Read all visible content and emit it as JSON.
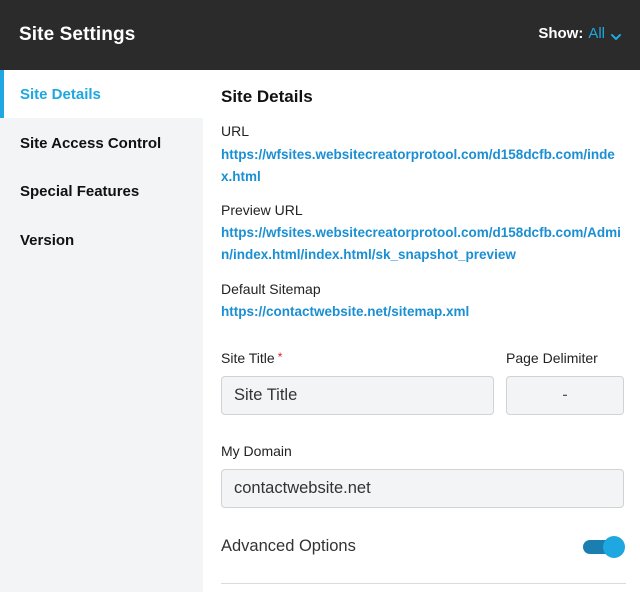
{
  "header": {
    "title": "Site Settings",
    "show_label": "Show:",
    "show_value": "All"
  },
  "sidebar": {
    "items": [
      {
        "label": "Site Details",
        "active": true
      },
      {
        "label": "Site Access Control",
        "active": false
      },
      {
        "label": "Special Features",
        "active": false
      },
      {
        "label": "Version",
        "active": false
      }
    ]
  },
  "main": {
    "section_title": "Site Details",
    "url_label": "URL",
    "url_value": "https://wfsites.websitecreatorprotool.com/d158dcfb.com/index.html",
    "preview_url_label": "Preview URL",
    "preview_url_value": "https://wfsites.websitecreatorprotool.com/d158dcfb.com/Admin/index.html/index.html/sk_snapshot_preview",
    "sitemap_label": "Default Sitemap",
    "sitemap_value": "https://contactwebsite.net/sitemap.xml",
    "site_title_label": "Site Title",
    "site_title_required": "*",
    "site_title_value": "Site Title",
    "delimiter_label": "Page Delimiter",
    "delimiter_value": "-",
    "domain_label": "My Domain",
    "domain_value": "contactwebsite.net",
    "advanced_label": "Advanced Options",
    "advanced_enabled": true
  },
  "colors": {
    "accent": "#1ea7e1",
    "link": "#1a8fd3",
    "header_bg": "#2b2b2b",
    "sidebar_bg": "#f3f4f5",
    "required": "#e0201e"
  },
  "icons": {
    "show_dropdown": "chevron-down-icon"
  }
}
